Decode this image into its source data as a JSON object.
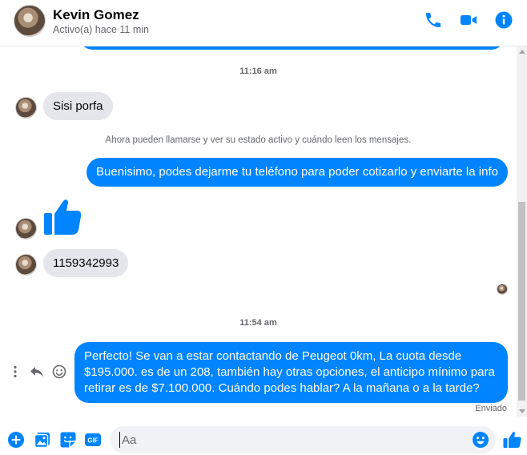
{
  "header": {
    "name": "Kevin Gomez",
    "status": "Activo(a) hace 11 min",
    "icons": [
      "phone-icon",
      "video-camera-icon",
      "info-icon"
    ]
  },
  "colors": {
    "accent": "#0084ff",
    "incoming_bubble": "#e4e6eb",
    "muted_text": "#65676b"
  },
  "messages": {
    "time_1": "11:16 am",
    "msg_in_1": "Sisi porfa",
    "system": "Ahora pueden llamarse y ver su estado activo y cuándo leen los mensajes.",
    "msg_out_1": "Buenisimo, podes dejarme tu teléfono para poder cotizarlo y enviarte la info",
    "msg_in_like": "thumbs-up-icon",
    "msg_in_2": "1159342993",
    "time_2": "11:54 am",
    "msg_out_2": "Perfecto!  Se van a estar contactando de Peugeot 0km, La cuota desde $195.000. es de un 208, también hay otras opciones, el anticipo mínimo para retirar es de $7.100.000. Cuándo podes hablar? A la mañana o a la tarde?",
    "sent_status": "Enviado"
  },
  "composer": {
    "placeholder": "Aa",
    "icons": [
      "plus-icon",
      "image-icon",
      "sticker-icon",
      "gif-icon",
      "emoji-icon",
      "like-icon"
    ],
    "gif_label": "GIF"
  }
}
